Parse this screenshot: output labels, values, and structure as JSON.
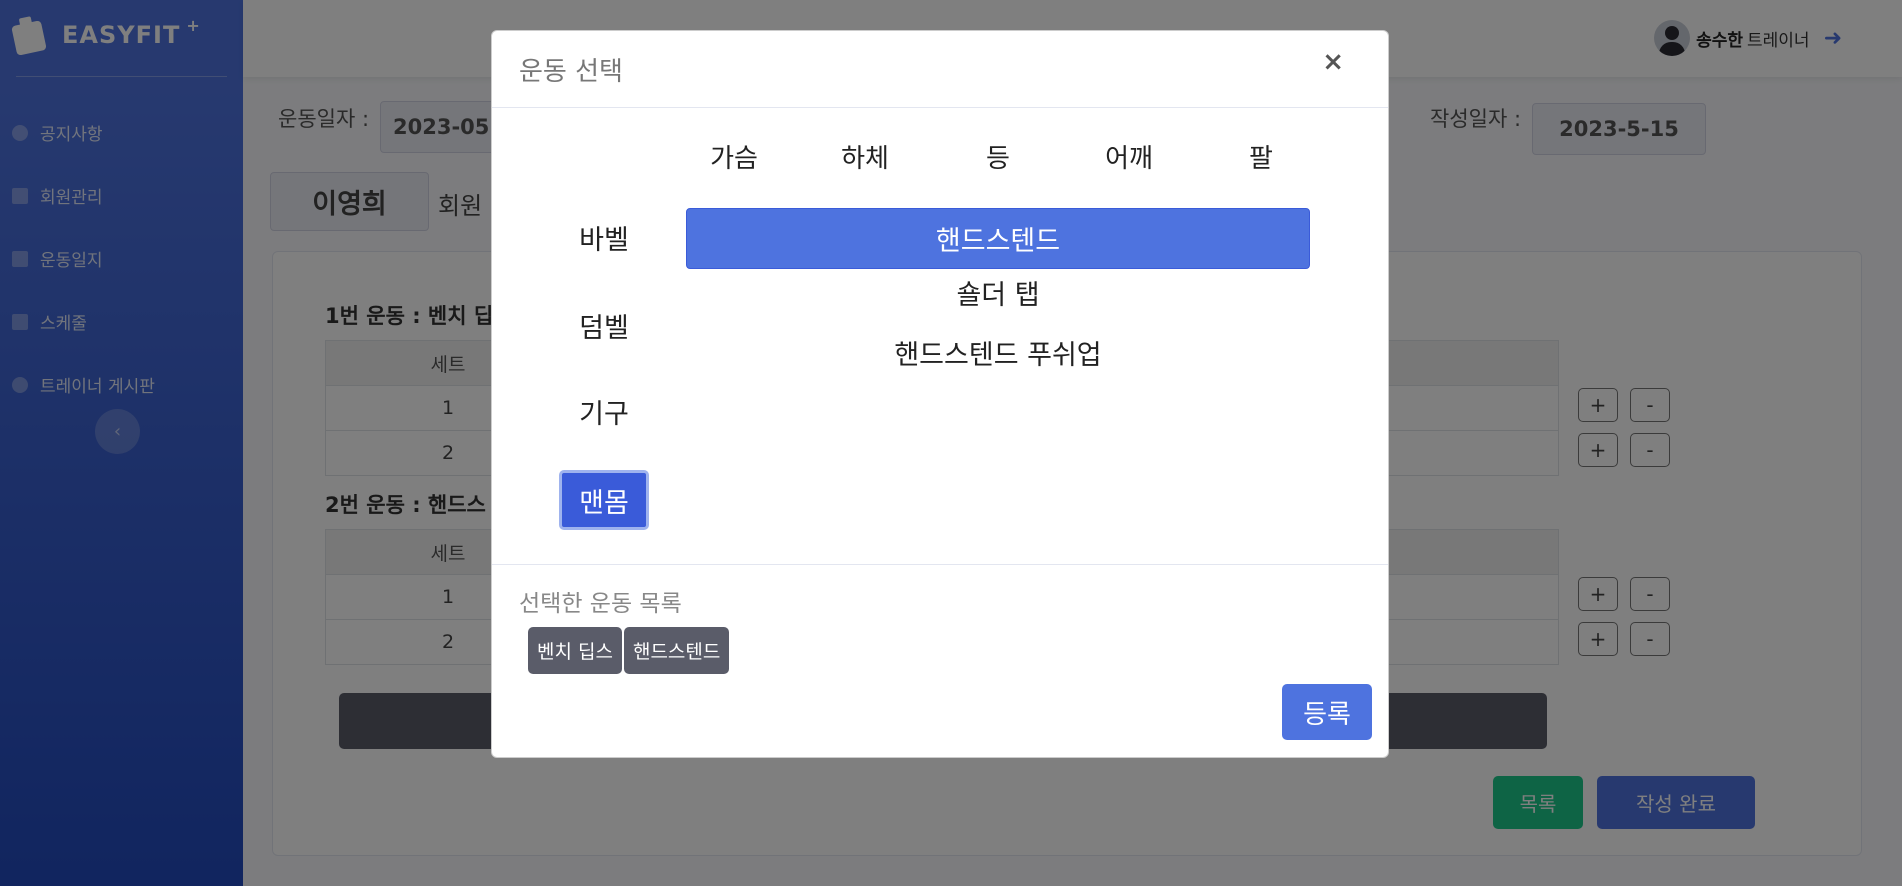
{
  "brand": {
    "name": "EASYFIT",
    "sup": "+"
  },
  "sidebar": {
    "items": [
      {
        "label": "공지사항",
        "icon": "info-circle-icon"
      },
      {
        "label": "회원관리",
        "icon": "user-edit-icon"
      },
      {
        "label": "운동일지",
        "icon": "book-icon"
      },
      {
        "label": "스케줄",
        "icon": "calendar-icon"
      },
      {
        "label": "트레이너 게시판",
        "icon": "info-circle-icon"
      }
    ],
    "toggle_glyph": "‹"
  },
  "topbar": {
    "user_name": "송수한",
    "user_role": "트레이너",
    "logout_glyph": "➜"
  },
  "form": {
    "exercise_date_label": "운동일자 :",
    "exercise_date_value": "2023-05",
    "written_date_label": "작성일자 :",
    "written_date_value": "2023-5-15",
    "member_name": "이영희",
    "member_label": "회원",
    "ex1_title": "1번 운동 : 벤치 딥",
    "ex2_title": "2번 운동 : 핸드스",
    "set_header": "세트",
    "ex1_rows": [
      "1",
      "2"
    ],
    "ex2_rows": [
      "1",
      "2"
    ],
    "plus": "+",
    "minus": "-",
    "list_button": "목록",
    "done_button": "작성 완료"
  },
  "modal": {
    "title": "운동 선택",
    "close": "×",
    "categories": [
      "가슴",
      "하체",
      "등",
      "어깨",
      "팔"
    ],
    "equipment": [
      {
        "label": "바벨",
        "active": false
      },
      {
        "label": "덤벨",
        "active": false
      },
      {
        "label": "기구",
        "active": false
      },
      {
        "label": "맨몸",
        "active": true
      }
    ],
    "exercises": [
      {
        "label": "핸드스텐드",
        "active": true
      },
      {
        "label": "숄더 탭",
        "active": false
      },
      {
        "label": "핸드스텐드 푸쉬업",
        "active": false
      }
    ],
    "selected_label": "선택한 운동 목록",
    "selected": [
      "벤치 딥스",
      "핸드스텐드"
    ],
    "register": "등록"
  },
  "colors": {
    "primary": "#4e73df",
    "success": "#1cc88a",
    "dark": "#5a5c69"
  }
}
